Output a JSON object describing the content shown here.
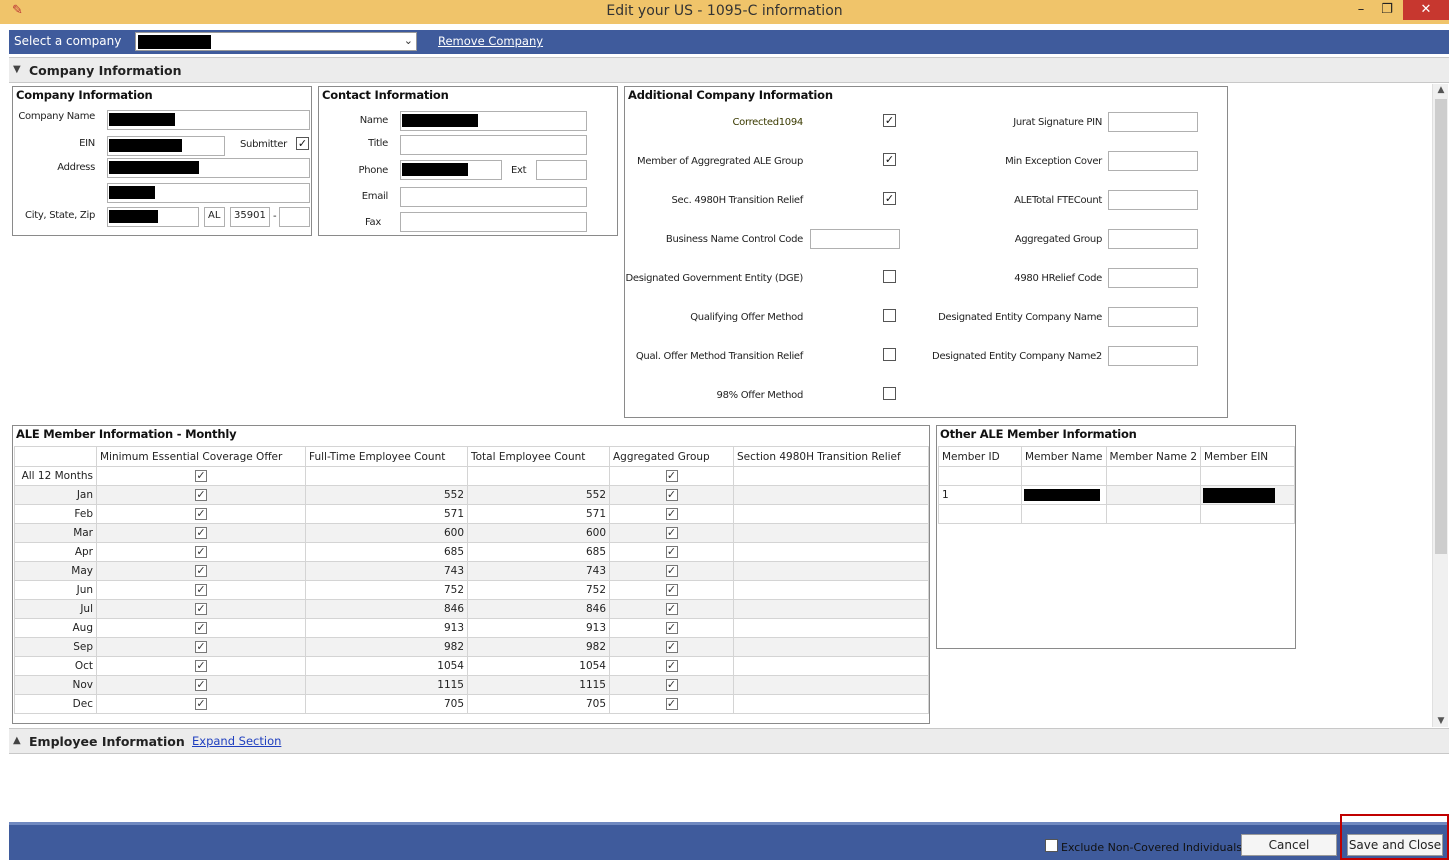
{
  "window": {
    "title": "Edit your US - 1095-C information",
    "minimize": "–",
    "restore": "❐",
    "close": "✕"
  },
  "company_bar": {
    "select_label": "Select a company",
    "selected_value": "",
    "remove_link": "Remove Company"
  },
  "company_section": {
    "header": "Company Information",
    "company_info": {
      "title": "Company Information",
      "company_name_label": "Company Name",
      "ein_label": "EIN",
      "submitter_label": "Submitter",
      "submitter_checked": true,
      "address_label": "Address",
      "city_state_zip_label": "City, State, Zip",
      "state": "AL",
      "zip": "35901",
      "zip_sep": "-"
    },
    "contact_info": {
      "title": "Contact Information",
      "name_label": "Name",
      "title_label": "Title",
      "phone_label": "Phone",
      "ext_label": "Ext",
      "email_label": "Email",
      "fax_label": "Fax"
    },
    "additional_info": {
      "title": "Additional Company Information",
      "left_items": [
        {
          "label": "Corrected1094",
          "checked": true
        },
        {
          "label": "Member of Aggregrated ALE Group",
          "checked": true
        },
        {
          "label": "Sec. 4980H Transition Relief",
          "checked": true
        },
        {
          "label": "Business Name Control Code",
          "field": true
        },
        {
          "label": "Designated Government Entity (DGE)",
          "checked": false
        },
        {
          "label": "Qualifying Offer Method",
          "checked": false
        },
        {
          "label": "Qual. Offer Method Transition Relief",
          "checked": false
        },
        {
          "label": "98% Offer Method",
          "checked": false
        }
      ],
      "right_items": [
        "Jurat Signature PIN",
        "Min Exception Cover",
        "ALETotal FTECount",
        "Aggregated Group",
        "4980 HRelief Code",
        "Designated Entity Company Name",
        "Designated Entity Company Name2"
      ]
    },
    "ale_monthly": {
      "title": "ALE Member Information - Monthly",
      "columns": [
        "",
        "Minimum Essential Coverage Offer",
        "Full-Time Employee Count",
        "Total Employee Count",
        "Aggregated Group",
        "Section 4980H Transition Relief"
      ],
      "rows": [
        {
          "month": "All 12 Months",
          "mec": true,
          "ft": "",
          "total": "",
          "agg": true
        },
        {
          "month": "Jan",
          "mec": true,
          "ft": "552",
          "total": "552",
          "agg": true
        },
        {
          "month": "Feb",
          "mec": true,
          "ft": "571",
          "total": "571",
          "agg": true
        },
        {
          "month": "Mar",
          "mec": true,
          "ft": "600",
          "total": "600",
          "agg": true
        },
        {
          "month": "Apr",
          "mec": true,
          "ft": "685",
          "total": "685",
          "agg": true
        },
        {
          "month": "May",
          "mec": true,
          "ft": "743",
          "total": "743",
          "agg": true
        },
        {
          "month": "Jun",
          "mec": true,
          "ft": "752",
          "total": "752",
          "agg": true
        },
        {
          "month": "Jul",
          "mec": true,
          "ft": "846",
          "total": "846",
          "agg": true
        },
        {
          "month": "Aug",
          "mec": true,
          "ft": "913",
          "total": "913",
          "agg": true
        },
        {
          "month": "Sep",
          "mec": true,
          "ft": "982",
          "total": "982",
          "agg": true
        },
        {
          "month": "Oct",
          "mec": true,
          "ft": "1054",
          "total": "1054",
          "agg": true
        },
        {
          "month": "Nov",
          "mec": true,
          "ft": "1115",
          "total": "1115",
          "agg": true
        },
        {
          "month": "Dec",
          "mec": true,
          "ft": "705",
          "total": "705",
          "agg": true
        }
      ]
    },
    "other_ale": {
      "title": "Other ALE Member Information",
      "columns": [
        "Member ID",
        "Member Name",
        "Member Name 2",
        "Member EIN"
      ],
      "rows": [
        {
          "id": "1"
        }
      ]
    }
  },
  "employee_section": {
    "header": "Employee Information",
    "expand_link": "Expand Section"
  },
  "footer": {
    "exclude_label": "Exclude Non-Covered Individuals",
    "cancel": "Cancel",
    "save_close": "Save and Close"
  },
  "colors": {
    "title_bar": "#f0c46a",
    "blue_bar": "#3f5b9c",
    "close_red": "#c7372f",
    "highlight_red": "#c00000"
  }
}
